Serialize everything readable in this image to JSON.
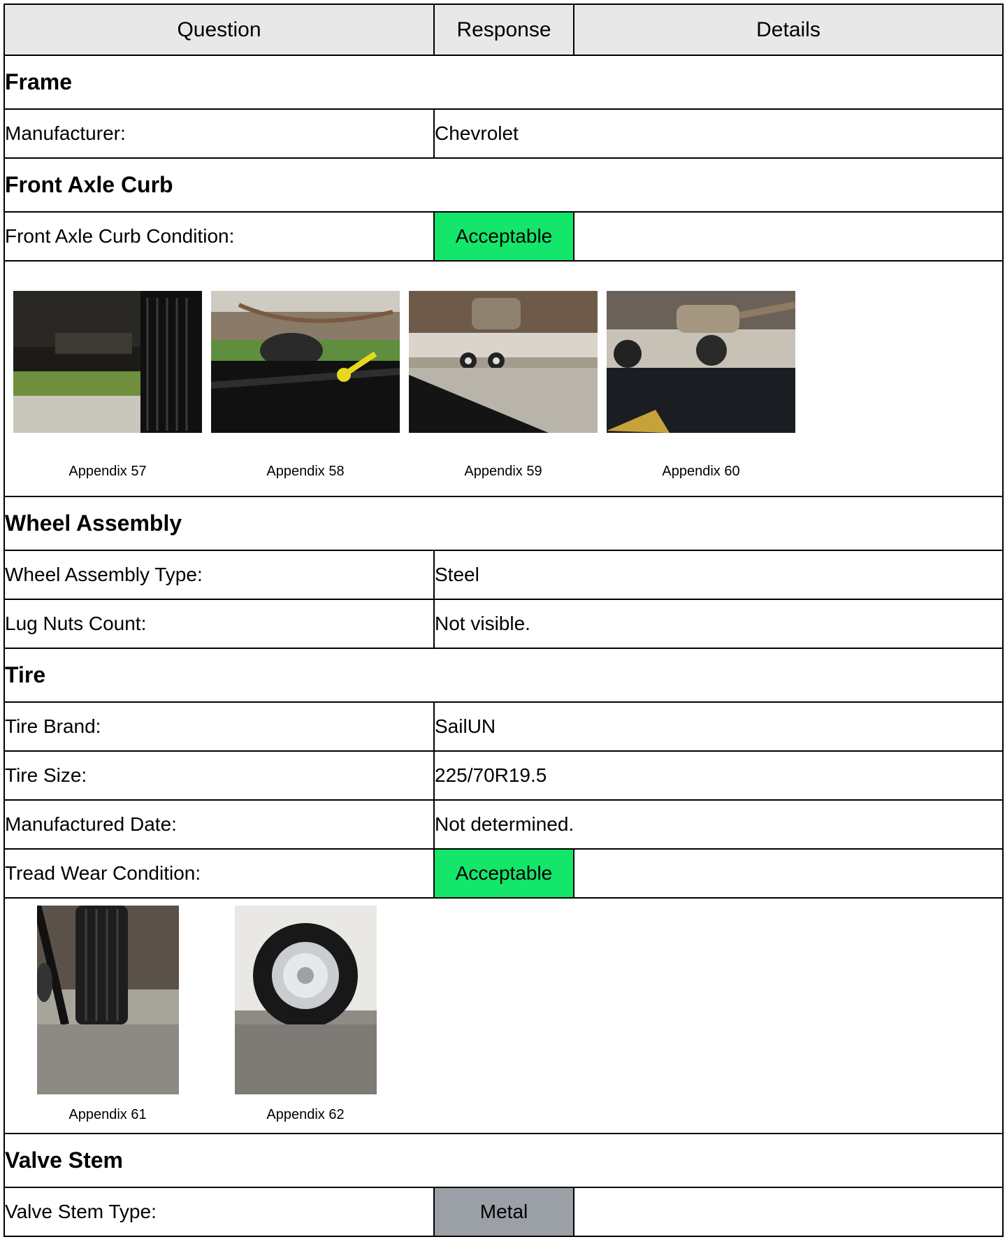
{
  "header": {
    "question": "Question",
    "response": "Response",
    "details": "Details"
  },
  "sections": {
    "frame": {
      "title": "Frame",
      "manufacturer": {
        "q": "Manufacturer:",
        "a": "Chevrolet"
      }
    },
    "front_axle": {
      "title": "Front Axle Curb",
      "condition": {
        "q": "Front Axle Curb Condition:",
        "a": "Acceptable"
      },
      "photos": [
        "Appendix 57",
        "Appendix 58",
        "Appendix 59",
        "Appendix 60"
      ]
    },
    "wheel": {
      "title": "Wheel Assembly",
      "type": {
        "q": "Wheel Assembly Type:",
        "a": "Steel"
      },
      "lug_nuts": {
        "q": "Lug Nuts Count:",
        "a": "Not visible."
      }
    },
    "tire": {
      "title": "Tire",
      "brand": {
        "q": "Tire Brand:",
        "a": "SailUN"
      },
      "size": {
        "q": "Tire Size:",
        "a": "225/70R19.5"
      },
      "date": {
        "q": "Manufactured Date:",
        "a": "Not determined."
      },
      "tread": {
        "q": "Tread Wear Condition:",
        "a": "Acceptable"
      },
      "photos": [
        "Appendix 61",
        "Appendix 62"
      ]
    },
    "valve": {
      "title": "Valve Stem",
      "type": {
        "q": "Valve Stem Type:",
        "a": "Metal"
      }
    }
  },
  "colors": {
    "acceptable": "#14e66b",
    "neutral": "#9aa0a6",
    "header_bg": "#e8e8e8"
  }
}
